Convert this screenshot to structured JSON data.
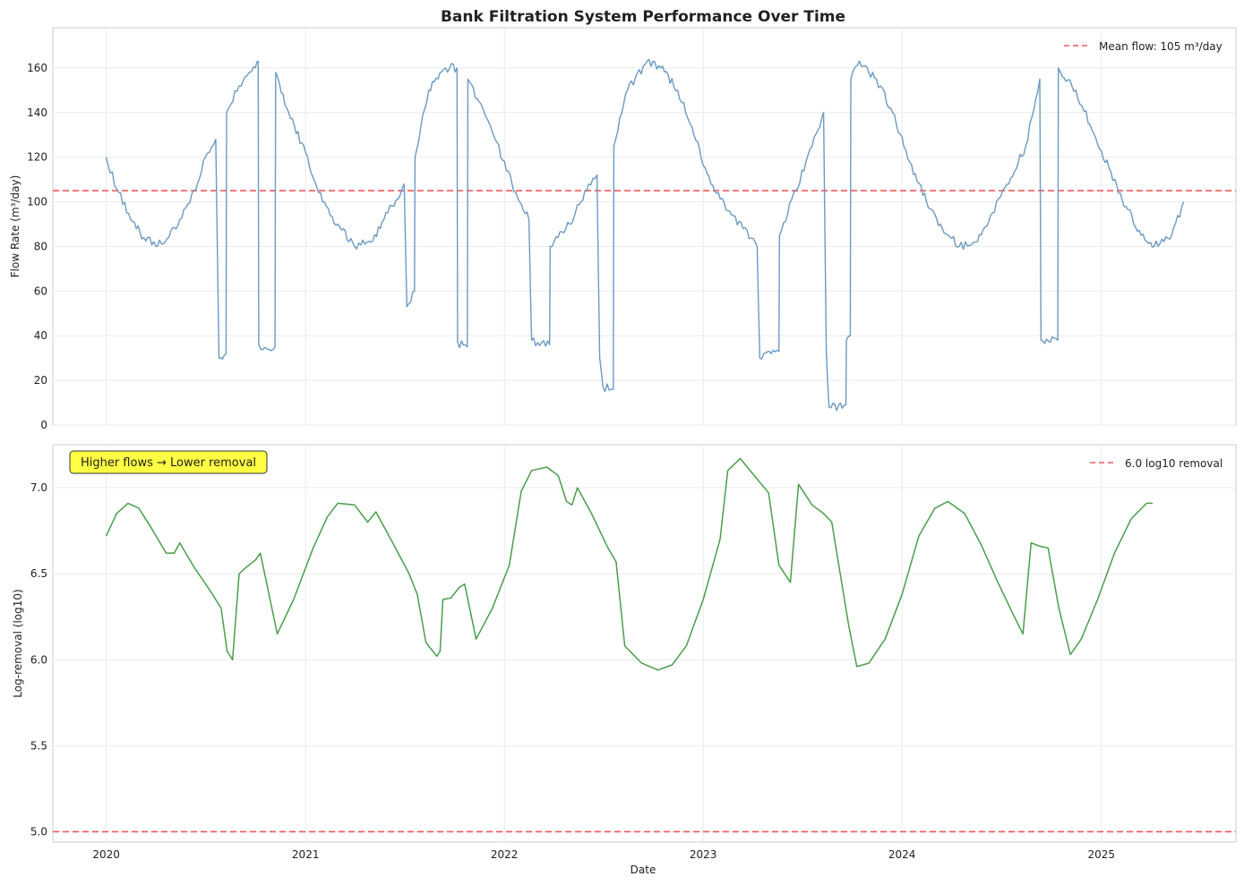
{
  "chart_data": [
    {
      "type": "line",
      "title": "Bank Filtration System Performance Over Time",
      "xlabel": "",
      "ylabel": "Flow Rate (m³/day)",
      "x_range": [
        "2019-09-25",
        "2025-09-05"
      ],
      "xticks": [
        "2020",
        "2021",
        "2022",
        "2023",
        "2024",
        "2025"
      ],
      "ylim": [
        0,
        178
      ],
      "yticks": [
        "0",
        "20",
        "40",
        "60",
        "80",
        "100",
        "120",
        "140",
        "160"
      ],
      "grid": true,
      "legend_position": "top-right",
      "reference_line": {
        "label": "Mean flow: 105 m³/day",
        "y": 105,
        "color": "#f05a5a",
        "style": "dashed"
      },
      "series": [
        {
          "color": "#5b8fbd",
          "points": [
            [
              "2020-01-01",
              120
            ],
            [
              "2020-01-20",
              106
            ],
            [
              "2020-02-15",
              92
            ],
            [
              "2020-03-10",
              84
            ],
            [
              "2020-04-01",
              80
            ],
            [
              "2020-04-25",
              84
            ],
            [
              "2020-05-15",
              92
            ],
            [
              "2020-06-10",
              105
            ],
            [
              "2020-07-01",
              120
            ],
            [
              "2020-07-20",
              128
            ],
            [
              "2020-07-26",
              30
            ],
            [
              "2020-08-08",
              32
            ],
            [
              "2020-08-09",
              140
            ],
            [
              "2020-09-01",
              152
            ],
            [
              "2020-10-01",
              160
            ],
            [
              "2020-10-06",
              163
            ],
            [
              "2020-10-07",
              36
            ],
            [
              "2020-11-06",
              35
            ],
            [
              "2020-11-07",
              158
            ],
            [
              "2020-12-01",
              140
            ],
            [
              "2021-01-01",
              122
            ],
            [
              "2021-02-01",
              100
            ],
            [
              "2021-03-01",
              90
            ],
            [
              "2021-04-01",
              80
            ],
            [
              "2021-05-01",
              82
            ],
            [
              "2021-06-01",
              95
            ],
            [
              "2021-07-01",
              108
            ],
            [
              "2021-07-06",
              53
            ],
            [
              "2021-07-20",
              60
            ],
            [
              "2021-07-21",
              120
            ],
            [
              "2021-08-15",
              150
            ],
            [
              "2021-09-15",
              160
            ],
            [
              "2021-10-06",
              160
            ],
            [
              "2021-10-07",
              37
            ],
            [
              "2021-10-25",
              35
            ],
            [
              "2021-10-26",
              155
            ],
            [
              "2021-11-15",
              145
            ],
            [
              "2021-12-15",
              128
            ],
            [
              "2022-01-15",
              108
            ],
            [
              "2022-02-15",
              92
            ],
            [
              "2022-02-20",
              38
            ],
            [
              "2022-03-25",
              36
            ],
            [
              "2022-03-26",
              80
            ],
            [
              "2022-05-01",
              90
            ],
            [
              "2022-06-01",
              105
            ],
            [
              "2022-06-20",
              112
            ],
            [
              "2022-06-25",
              30
            ],
            [
              "2022-07-01",
              17
            ],
            [
              "2022-07-20",
              16
            ],
            [
              "2022-07-21",
              125
            ],
            [
              "2022-08-15",
              150
            ],
            [
              "2022-09-20",
              163
            ],
            [
              "2022-10-15",
              160
            ],
            [
              "2022-11-15",
              150
            ],
            [
              "2022-12-15",
              130
            ],
            [
              "2023-01-15",
              108
            ],
            [
              "2023-02-15",
              96
            ],
            [
              "2023-03-15",
              88
            ],
            [
              "2023-04-10",
              80
            ],
            [
              "2023-04-15",
              30
            ],
            [
              "2023-05-20",
              33
            ],
            [
              "2023-05-21",
              85
            ],
            [
              "2023-06-20",
              105
            ],
            [
              "2023-07-20",
              125
            ],
            [
              "2023-08-10",
              140
            ],
            [
              "2023-08-15",
              33
            ],
            [
              "2023-08-20",
              8
            ],
            [
              "2023-09-20",
              9
            ],
            [
              "2023-09-21",
              38
            ],
            [
              "2023-09-28",
              40
            ],
            [
              "2023-09-29",
              155
            ],
            [
              "2023-10-15",
              163
            ],
            [
              "2023-11-15",
              155
            ],
            [
              "2023-12-15",
              140
            ],
            [
              "2024-01-15",
              118
            ],
            [
              "2024-02-15",
              100
            ],
            [
              "2024-03-15",
              88
            ],
            [
              "2024-04-15",
              80
            ],
            [
              "2024-05-15",
              82
            ],
            [
              "2024-06-15",
              95
            ],
            [
              "2024-07-15",
              108
            ],
            [
              "2024-08-15",
              125
            ],
            [
              "2024-09-10",
              155
            ],
            [
              "2024-09-12",
              38
            ],
            [
              "2024-10-13",
              38
            ],
            [
              "2024-10-14",
              160
            ],
            [
              "2024-11-15",
              150
            ],
            [
              "2024-12-15",
              132
            ],
            [
              "2025-01-15",
              115
            ],
            [
              "2025-02-15",
              98
            ],
            [
              "2025-03-15",
              85
            ],
            [
              "2025-04-15",
              80
            ],
            [
              "2025-05-10",
              85
            ],
            [
              "2025-06-01",
              100
            ]
          ]
        }
      ]
    },
    {
      "type": "line",
      "title": "",
      "xlabel": "Date",
      "ylabel": "Log-removal (log10)",
      "x_range": [
        "2019-09-25",
        "2025-09-05"
      ],
      "xticks": [
        "2020",
        "2021",
        "2022",
        "2023",
        "2024",
        "2025"
      ],
      "ylim": [
        4.94,
        7.25
      ],
      "yticks": [
        "5.0",
        "5.5",
        "6.0",
        "6.5",
        "7.0"
      ],
      "grid": true,
      "legend_position": "top-right",
      "annotation": "Higher flows → Lower removal",
      "annotation_color": "#ffff44",
      "reference_line": {
        "label": "6.0 log10 removal",
        "y": 5.0,
        "color": "#f05a5a",
        "style": "dashed"
      },
      "series": [
        {
          "color": "#4a9e4a",
          "points": [
            [
              "2020-01-01",
              6.72
            ],
            [
              "2020-01-20",
              6.85
            ],
            [
              "2020-02-10",
              6.91
            ],
            [
              "2020-03-01",
              6.88
            ],
            [
              "2020-03-25",
              6.76
            ],
            [
              "2020-04-20",
              6.62
            ],
            [
              "2020-05-05",
              6.62
            ],
            [
              "2020-05-15",
              6.68
            ],
            [
              "2020-06-10",
              6.54
            ],
            [
              "2020-07-10",
              6.4
            ],
            [
              "2020-07-30",
              6.3
            ],
            [
              "2020-08-10",
              6.05
            ],
            [
              "2020-08-20",
              6.0
            ],
            [
              "2020-09-01",
              6.5
            ],
            [
              "2020-09-15",
              6.54
            ],
            [
              "2020-10-01",
              6.58
            ],
            [
              "2020-10-10",
              6.62
            ],
            [
              "2020-11-10",
              6.15
            ],
            [
              "2020-12-10",
              6.35
            ],
            [
              "2021-01-15",
              6.65
            ],
            [
              "2021-02-10",
              6.83
            ],
            [
              "2021-03-01",
              6.91
            ],
            [
              "2021-04-01",
              6.9
            ],
            [
              "2021-04-25",
              6.8
            ],
            [
              "2021-05-10",
              6.86
            ],
            [
              "2021-06-10",
              6.68
            ],
            [
              "2021-07-10",
              6.5
            ],
            [
              "2021-07-25",
              6.38
            ],
            [
              "2021-08-10",
              6.1
            ],
            [
              "2021-08-30",
              6.02
            ],
            [
              "2021-09-05",
              6.05
            ],
            [
              "2021-09-10",
              6.35
            ],
            [
              "2021-09-25",
              6.36
            ],
            [
              "2021-10-10",
              6.42
            ],
            [
              "2021-10-20",
              6.44
            ],
            [
              "2021-11-10",
              6.12
            ],
            [
              "2021-12-10",
              6.3
            ],
            [
              "2022-01-10",
              6.55
            ],
            [
              "2022-02-01",
              6.98
            ],
            [
              "2022-02-20",
              7.1
            ],
            [
              "2022-03-20",
              7.12
            ],
            [
              "2022-04-10",
              7.07
            ],
            [
              "2022-04-25",
              6.92
            ],
            [
              "2022-05-05",
              6.9
            ],
            [
              "2022-05-15",
              7.0
            ],
            [
              "2022-06-10",
              6.85
            ],
            [
              "2022-07-10",
              6.65
            ],
            [
              "2022-07-25",
              6.57
            ],
            [
              "2022-08-10",
              6.08
            ],
            [
              "2022-09-10",
              5.98
            ],
            [
              "2022-10-10",
              5.94
            ],
            [
              "2022-11-05",
              5.97
            ],
            [
              "2022-12-01",
              6.08
            ],
            [
              "2023-01-01",
              6.35
            ],
            [
              "2023-02-01",
              6.7
            ],
            [
              "2023-02-15",
              7.1
            ],
            [
              "2023-03-10",
              7.17
            ],
            [
              "2023-04-10",
              7.05
            ],
            [
              "2023-05-01",
              6.97
            ],
            [
              "2023-05-20",
              6.55
            ],
            [
              "2023-06-10",
              6.45
            ],
            [
              "2023-06-25",
              7.02
            ],
            [
              "2023-07-20",
              6.9
            ],
            [
              "2023-08-10",
              6.85
            ],
            [
              "2023-08-25",
              6.8
            ],
            [
              "2023-09-25",
              6.2
            ],
            [
              "2023-10-10",
              5.96
            ],
            [
              "2023-11-01",
              5.98
            ],
            [
              "2023-12-01",
              6.12
            ],
            [
              "2024-01-01",
              6.38
            ],
            [
              "2024-02-01",
              6.72
            ],
            [
              "2024-03-01",
              6.88
            ],
            [
              "2024-03-25",
              6.92
            ],
            [
              "2024-04-25",
              6.85
            ],
            [
              "2024-05-25",
              6.67
            ],
            [
              "2024-06-25",
              6.45
            ],
            [
              "2024-07-25",
              6.25
            ],
            [
              "2024-08-10",
              6.15
            ],
            [
              "2024-08-25",
              6.68
            ],
            [
              "2024-09-10",
              6.66
            ],
            [
              "2024-09-25",
              6.65
            ],
            [
              "2024-10-15",
              6.3
            ],
            [
              "2024-11-05",
              6.03
            ],
            [
              "2024-11-25",
              6.12
            ],
            [
              "2024-12-25",
              6.35
            ],
            [
              "2025-01-25",
              6.62
            ],
            [
              "2025-02-25",
              6.82
            ],
            [
              "2025-03-25",
              6.91
            ],
            [
              "2025-04-05",
              6.91
            ]
          ]
        }
      ]
    }
  ]
}
